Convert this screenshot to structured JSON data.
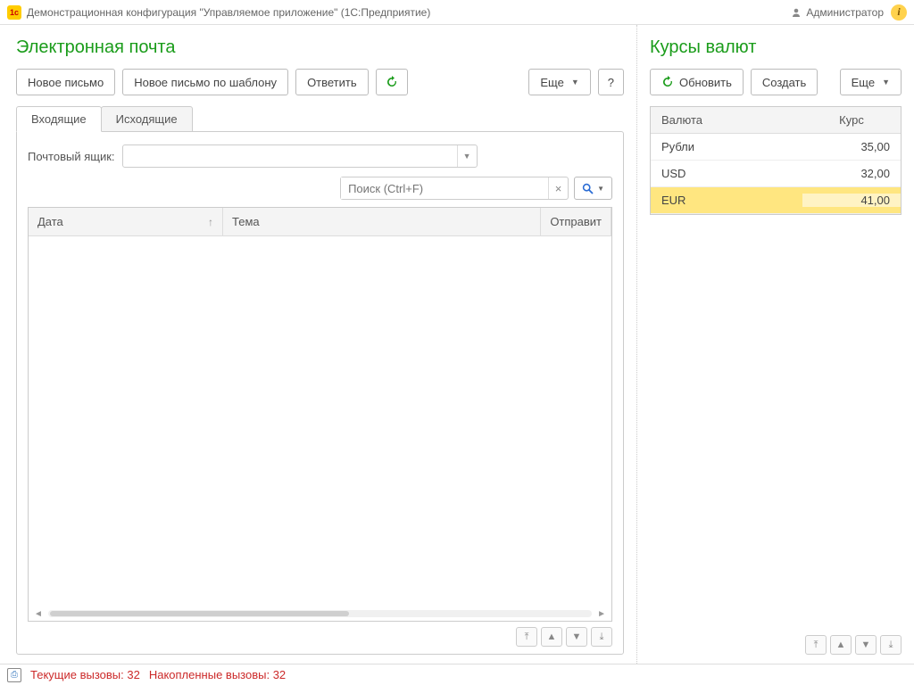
{
  "header": {
    "title": "Демонстрационная конфигурация \"Управляемое приложение\"  (1С:Предприятие)",
    "user": "Администратор"
  },
  "email": {
    "title": "Электронная почта",
    "buttons": {
      "new": "Новое письмо",
      "new_template": "Новое письмо по шаблону",
      "reply": "Ответить",
      "more": "Еще",
      "help": "?"
    },
    "tabs": {
      "inbox": "Входящие",
      "outbox": "Исходящие"
    },
    "mailbox_label": "Почтовый ящик:",
    "search_placeholder": "Поиск (Ctrl+F)",
    "columns": {
      "date": "Дата",
      "subject": "Тема",
      "sender": "Отправит"
    }
  },
  "rates": {
    "title": "Курсы валют",
    "buttons": {
      "refresh": "Обновить",
      "create": "Создать",
      "more": "Еще"
    },
    "columns": {
      "currency": "Валюта",
      "rate": "Курс"
    },
    "rows": [
      {
        "name": "Рубли",
        "rate": "35,00"
      },
      {
        "name": "USD",
        "rate": "32,00"
      },
      {
        "name": "EUR",
        "rate": "41,00"
      }
    ]
  },
  "status": {
    "current_calls_label": "Текущие вызовы:",
    "current_calls_value": "32",
    "accum_calls_label": "Накопленные вызовы:",
    "accum_calls_value": "32"
  }
}
